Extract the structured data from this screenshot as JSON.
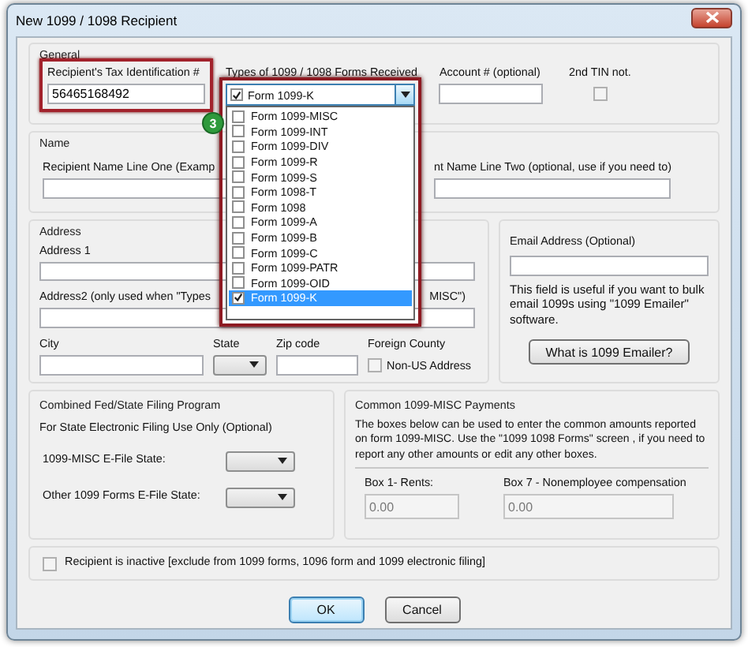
{
  "window": {
    "title": "New 1099 / 1098 Recipient"
  },
  "general": {
    "title": "General",
    "tin": {
      "label": "Recipient's Tax Identification #",
      "value": "56465168492",
      "highlighted": true
    },
    "form_types": {
      "label": "Types of 1099 / 1098 Forms Received",
      "value": "Form 1099-K",
      "checked": true,
      "expanded": true,
      "step": "3",
      "options": [
        {
          "label": "Form 1099-MISC",
          "checked": false,
          "selected": false
        },
        {
          "label": "Form 1099-INT",
          "checked": false,
          "selected": false
        },
        {
          "label": "Form 1099-DIV",
          "checked": false,
          "selected": false
        },
        {
          "label": "Form 1099-R",
          "checked": false,
          "selected": false
        },
        {
          "label": "Form 1099-S",
          "checked": false,
          "selected": false
        },
        {
          "label": "Form 1098-T",
          "checked": false,
          "selected": false
        },
        {
          "label": "Form 1098",
          "checked": false,
          "selected": false
        },
        {
          "label": "Form 1099-A",
          "checked": false,
          "selected": false
        },
        {
          "label": "Form 1099-B",
          "checked": false,
          "selected": false
        },
        {
          "label": "Form 1099-C",
          "checked": false,
          "selected": false
        },
        {
          "label": "Form 1099-PATR",
          "checked": false,
          "selected": false
        },
        {
          "label": "Form 1099-OID",
          "checked": false,
          "selected": false
        },
        {
          "label": "Form 1099-K",
          "checked": true,
          "selected": true
        }
      ]
    },
    "account": {
      "label": "Account # (optional)"
    },
    "second_tin": {
      "label": "2nd TIN not.",
      "checked": false
    }
  },
  "name": {
    "title": "Name",
    "line_one_label": "Recipient Name Line One (Examp",
    "line_two_label": "nt Name Line Two (optional, use if you need to)"
  },
  "address": {
    "title": "Address",
    "address1_label": "Address 1",
    "address2_label_start": "Address2 (only used when \"Types",
    "address2_label_end": "MISC\")",
    "city_label": "City",
    "state_label": "State",
    "zip_label": "Zip code",
    "foreign_label": "Foreign County",
    "non_us": {
      "label": "Non-US Address",
      "checked": false
    }
  },
  "email": {
    "label": "Email Address (Optional)",
    "note": "This field is useful if you want to bulk email 1099s using \"1099 Emailer\" software.",
    "button": "What is 1099 Emailer?"
  },
  "combined": {
    "title": "Combined Fed/State Filing Program",
    "subtitle": "For State Electronic Filing Use Only (Optional)",
    "states": [
      {
        "label": "1099-MISC E-File State:"
      },
      {
        "label": "Other 1099 Forms E-File State:"
      }
    ]
  },
  "payments": {
    "title": "Common 1099-MISC Payments",
    "note": "The boxes below can be used to enter the common amounts reported on form 1099-MISC. Use the \"1099  1098 Forms\" screen , if you need to report any other amounts or edit any other boxes.",
    "boxes": [
      {
        "label": "Box 1- Rents:",
        "value": "0.00",
        "disabled": true
      },
      {
        "label": "Box 7 - Nonemployee compensation",
        "value": "0.00",
        "disabled": true
      }
    ]
  },
  "inactive": {
    "label": "Recipient is inactive [exclude from 1099 forms, 1096 form and 1099 electronic filing]",
    "checked": false
  },
  "buttons": [
    {
      "label": "OK",
      "default": true
    },
    {
      "label": "Cancel",
      "default": false
    }
  ]
}
